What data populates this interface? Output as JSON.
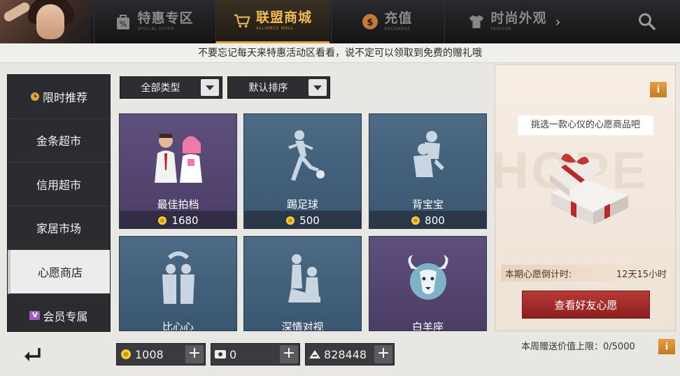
{
  "tabs": [
    {
      "label": "特惠专区",
      "sub": "SPECIAL OFFER",
      "icon": "percent-bag-icon",
      "active": false
    },
    {
      "label": "联盟商城",
      "sub": "ALLIANCE MALL",
      "icon": "shopping-cart-icon",
      "active": true
    },
    {
      "label": "充值",
      "sub": "RECHARGE",
      "icon": "coin-icon",
      "active": false
    },
    {
      "label": "时尚外观",
      "sub": "FASHION",
      "icon": "shirt-icon",
      "active": false
    }
  ],
  "notice": "不要忘记每天来特惠活动区看看，说不定可以领取到免费的赠礼哦",
  "sidebar": [
    {
      "label": "限时推荐",
      "icon": "clock-icon"
    },
    {
      "label": "金条超市"
    },
    {
      "label": "信用超市"
    },
    {
      "label": "家居市场"
    },
    {
      "label": "心愿商店",
      "active": true
    },
    {
      "label": "会员专属",
      "icon": "vip-icon"
    }
  ],
  "filters": {
    "type": "全部类型",
    "sort": "默认排序"
  },
  "cards": [
    {
      "name": "最佳拍档",
      "price": "1680",
      "style": "purple",
      "art": "couple-figures-icon"
    },
    {
      "name": "踢足球",
      "price": "500",
      "style": "blue",
      "art": "kick-ball-icon"
    },
    {
      "name": "背宝宝",
      "price": "800",
      "style": "blue",
      "art": "piggyback-icon"
    },
    {
      "name": "比心心",
      "style": "blue",
      "art": "heart-pose-icon"
    },
    {
      "name": "深情对视",
      "style": "blue",
      "art": "gaze-pose-icon"
    },
    {
      "name": "白羊座",
      "style": "purple",
      "art": "aries-icon"
    }
  ],
  "wish": {
    "hint": "挑选一款心仪的心愿商品吧",
    "watermark": "HOPE",
    "countdown_label": "本期心愿倒计时:",
    "countdown_value": "12天15小时",
    "friend_button": "查看好友心愿",
    "info": "i"
  },
  "currencies": [
    {
      "icon": "coin-icon",
      "value": "1008"
    },
    {
      "icon": "ticket-icon",
      "value": "0"
    },
    {
      "icon": "credit-icon",
      "value": "828448"
    }
  ],
  "weekly_limit": "本周赠送价值上限：0/5000",
  "colors": {
    "accent_gold": "#f0bb55",
    "card_blue": "#4d6a86",
    "card_purple": "#5f4f7e",
    "friend_button_red": "#a12d2a"
  }
}
